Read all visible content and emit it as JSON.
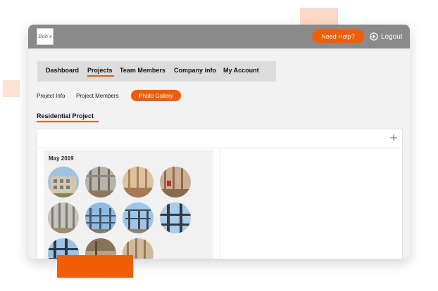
{
  "header": {
    "logo_text": "Bob's",
    "help_label": "Need Help?",
    "logout_label": "Logout"
  },
  "nav": {
    "items": [
      "Dashboard",
      "Projects",
      "Team Members",
      "Company info",
      "My Account"
    ],
    "active": "Projects"
  },
  "subtabs": {
    "items": [
      "Project Info",
      "Project Members",
      "Photo Gallery"
    ],
    "active": "Photo Gallery"
  },
  "section": {
    "title": "Residential Project"
  },
  "gallery": {
    "album_title": "May 2019",
    "photos": [
      {
        "subject": "apartment-building"
      },
      {
        "subject": "steel-framing-interior"
      },
      {
        "subject": "wood-framing-interior"
      },
      {
        "subject": "wood-framing-red"
      },
      {
        "subject": "metal-stud-walls"
      },
      {
        "subject": "steel-frame-blue-sky"
      },
      {
        "subject": "steel-frame-building"
      },
      {
        "subject": "steel-structure"
      },
      {
        "subject": "steel-structure-sky"
      },
      {
        "subject": "concrete-floor"
      },
      {
        "subject": "wood-framing-walls"
      }
    ]
  },
  "colors": {
    "accent": "#f25c05",
    "topbar": "#8a8a8a",
    "nav_bg": "#dcdcdc",
    "window_bg": "#f2f2f2"
  },
  "icons": [
    "logout-icon",
    "plus-icon"
  ]
}
